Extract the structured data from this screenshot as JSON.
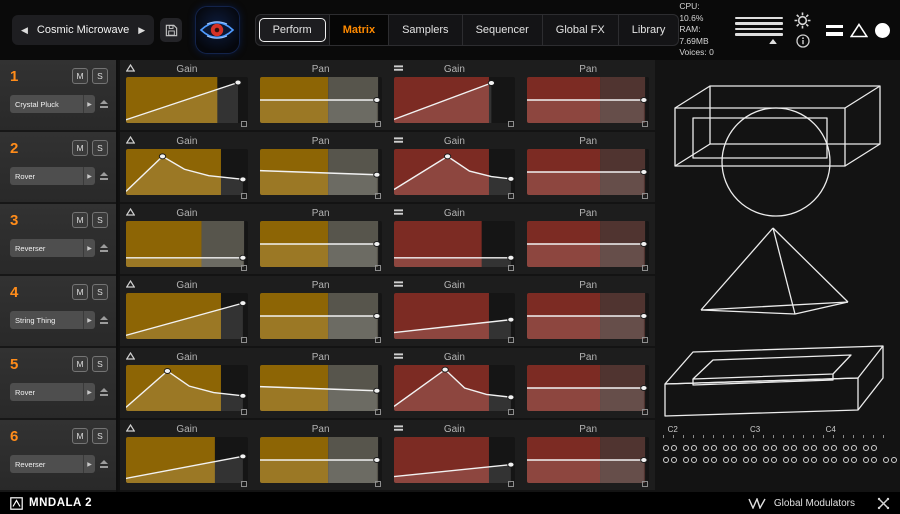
{
  "header": {
    "accent": "#ff8a00",
    "preset": {
      "prev_icon": "◀",
      "next_icon": "▶",
      "name": "Cosmic Microwave"
    },
    "tabs": [
      {
        "label": "Perform",
        "state": "outlined"
      },
      {
        "label": "Matrix",
        "state": "active"
      },
      {
        "label": "Samplers",
        "state": "normal"
      },
      {
        "label": "Sequencer",
        "state": "normal"
      },
      {
        "label": "Global FX",
        "state": "normal"
      },
      {
        "label": "Library",
        "state": "normal"
      }
    ],
    "stats": {
      "cpu": "CPU: 10.6%",
      "ram": "RAM: 7.69MB",
      "voices": "Voices: 0"
    }
  },
  "icons": {
    "select_arrow": "▶"
  },
  "sidebar": {
    "mute_label": "M",
    "solo_label": "S",
    "channels": [
      {
        "num": "1",
        "name": "Crystal Pluck"
      },
      {
        "num": "2",
        "name": "Rover"
      },
      {
        "num": "3",
        "name": "Reverser"
      },
      {
        "num": "4",
        "name": "String Thing"
      },
      {
        "num": "5",
        "name": "Rover"
      },
      {
        "num": "6",
        "name": "Reverser"
      }
    ]
  },
  "matrix": {
    "colors": {
      "amber": "#8d6505",
      "amber_soft": "#57554c",
      "red": "#7c2b23",
      "red_soft": "#503430",
      "line": "#f2f2f2"
    },
    "rows": [
      {
        "cells": [
          {
            "label": "Gain",
            "icon": "triangle",
            "zones": [
              [
                0,
                0.75,
                "amber"
              ]
            ],
            "pts": [
              [
                0,
                0.93
              ],
              [
                0.92,
                0.12
              ]
            ],
            "nodes": [
              [
                0.92,
                0.12
              ]
            ]
          },
          {
            "label": "Pan",
            "icon": "",
            "zones": [
              [
                0,
                0.56,
                "amber"
              ],
              [
                0.56,
                0.97,
                "amber_soft"
              ]
            ],
            "pts": [
              [
                0,
                0.5
              ],
              [
                0.96,
                0.5
              ]
            ],
            "nodes": [
              [
                0.96,
                0.5
              ]
            ]
          },
          {
            "label": "Gain",
            "icon": "bars",
            "zones": [
              [
                0,
                0.78,
                "red"
              ]
            ],
            "pts": [
              [
                0,
                0.92
              ],
              [
                0.8,
                0.13
              ]
            ],
            "nodes": [
              [
                0.8,
                0.13
              ]
            ]
          },
          {
            "label": "Pan",
            "icon": "",
            "zones": [
              [
                0,
                0.6,
                "red"
              ],
              [
                0.6,
                0.97,
                "red_soft"
              ]
            ],
            "pts": [
              [
                0,
                0.5
              ],
              [
                0.96,
                0.5
              ]
            ],
            "nodes": [
              [
                0.96,
                0.5
              ]
            ]
          }
        ]
      },
      {
        "cells": [
          {
            "label": "Gain",
            "icon": "triangle",
            "zones": [
              [
                0,
                0.78,
                "amber"
              ]
            ],
            "pts": [
              [
                0,
                0.92
              ],
              [
                0.3,
                0.16
              ],
              [
                0.48,
                0.44
              ],
              [
                0.68,
                0.58
              ],
              [
                0.96,
                0.66
              ]
            ],
            "nodes": [
              [
                0.3,
                0.16
              ],
              [
                0.96,
                0.66
              ]
            ]
          },
          {
            "label": "Pan",
            "icon": "",
            "zones": [
              [
                0,
                0.56,
                "amber"
              ],
              [
                0.56,
                0.97,
                "amber_soft"
              ]
            ],
            "pts": [
              [
                0,
                0.47
              ],
              [
                0.96,
                0.56
              ]
            ],
            "nodes": [
              [
                0.96,
                0.56
              ]
            ]
          },
          {
            "label": "Gain",
            "icon": "bars",
            "zones": [
              [
                0,
                0.78,
                "red"
              ]
            ],
            "pts": [
              [
                0,
                0.88
              ],
              [
                0.44,
                0.16
              ],
              [
                0.62,
                0.48
              ],
              [
                0.8,
                0.6
              ],
              [
                0.96,
                0.65
              ]
            ],
            "nodes": [
              [
                0.44,
                0.16
              ],
              [
                0.96,
                0.65
              ]
            ]
          },
          {
            "label": "Pan",
            "icon": "",
            "zones": [
              [
                0,
                0.6,
                "red"
              ],
              [
                0.6,
                0.97,
                "red_soft"
              ]
            ],
            "pts": [
              [
                0,
                0.5
              ],
              [
                0.96,
                0.5
              ]
            ],
            "nodes": [
              [
                0.96,
                0.5
              ]
            ]
          }
        ]
      },
      {
        "cells": [
          {
            "label": "Gain",
            "icon": "triangle",
            "zones": [
              [
                0,
                0.62,
                "amber"
              ],
              [
                0.62,
                0.97,
                "amber_soft"
              ]
            ],
            "pts": [
              [
                0,
                0.8
              ],
              [
                0.96,
                0.8
              ]
            ],
            "nodes": [
              [
                0.96,
                0.8
              ]
            ]
          },
          {
            "label": "Pan",
            "icon": "",
            "zones": [
              [
                0,
                0.56,
                "amber"
              ],
              [
                0.56,
                0.97,
                "amber_soft"
              ]
            ],
            "pts": [
              [
                0,
                0.5
              ],
              [
                0.96,
                0.5
              ]
            ],
            "nodes": [
              [
                0.96,
                0.5
              ]
            ]
          },
          {
            "label": "Gain",
            "icon": "bars",
            "zones": [
              [
                0,
                0.72,
                "red"
              ]
            ],
            "pts": [
              [
                0,
                0.8
              ],
              [
                0.96,
                0.8
              ]
            ],
            "nodes": [
              [
                0.96,
                0.8
              ]
            ]
          },
          {
            "label": "Pan",
            "icon": "",
            "zones": [
              [
                0,
                0.6,
                "red"
              ],
              [
                0.6,
                0.97,
                "red_soft"
              ]
            ],
            "pts": [
              [
                0,
                0.5
              ],
              [
                0.96,
                0.5
              ]
            ],
            "nodes": [
              [
                0.96,
                0.5
              ]
            ]
          }
        ]
      },
      {
        "cells": [
          {
            "label": "Gain",
            "icon": "triangle",
            "zones": [
              [
                0,
                0.78,
                "amber"
              ]
            ],
            "pts": [
              [
                0,
                0.92
              ],
              [
                0.96,
                0.22
              ]
            ],
            "nodes": [
              [
                0.96,
                0.22
              ]
            ]
          },
          {
            "label": "Pan",
            "icon": "",
            "zones": [
              [
                0,
                0.56,
                "amber"
              ],
              [
                0.56,
                0.97,
                "amber_soft"
              ]
            ],
            "pts": [
              [
                0,
                0.5
              ],
              [
                0.96,
                0.5
              ]
            ],
            "nodes": [
              [
                0.96,
                0.5
              ]
            ]
          },
          {
            "label": "Gain",
            "icon": "bars",
            "zones": [
              [
                0,
                0.78,
                "red"
              ]
            ],
            "pts": [
              [
                0,
                0.86
              ],
              [
                0.96,
                0.58
              ]
            ],
            "nodes": [
              [
                0.96,
                0.58
              ]
            ]
          },
          {
            "label": "Pan",
            "icon": "",
            "zones": [
              [
                0,
                0.6,
                "red"
              ],
              [
                0.6,
                0.97,
                "red_soft"
              ]
            ],
            "pts": [
              [
                0,
                0.5
              ],
              [
                0.96,
                0.5
              ]
            ],
            "nodes": [
              [
                0.96,
                0.5
              ]
            ]
          }
        ]
      },
      {
        "cells": [
          {
            "label": "Gain",
            "icon": "triangle",
            "zones": [
              [
                0,
                0.78,
                "amber"
              ]
            ],
            "pts": [
              [
                0,
                0.92
              ],
              [
                0.34,
                0.13
              ],
              [
                0.52,
                0.46
              ],
              [
                0.72,
                0.6
              ],
              [
                0.96,
                0.67
              ]
            ],
            "nodes": [
              [
                0.34,
                0.13
              ],
              [
                0.96,
                0.67
              ]
            ]
          },
          {
            "label": "Pan",
            "icon": "",
            "zones": [
              [
                0,
                0.56,
                "amber"
              ],
              [
                0.56,
                0.97,
                "amber_soft"
              ]
            ],
            "pts": [
              [
                0,
                0.47
              ],
              [
                0.96,
                0.56
              ]
            ],
            "nodes": [
              [
                0.96,
                0.56
              ]
            ]
          },
          {
            "label": "Gain",
            "icon": "bars",
            "zones": [
              [
                0,
                0.78,
                "red"
              ]
            ],
            "pts": [
              [
                0,
                0.9
              ],
              [
                0.42,
                0.1
              ],
              [
                0.58,
                0.5
              ],
              [
                0.76,
                0.64
              ],
              [
                0.96,
                0.7
              ]
            ],
            "nodes": [
              [
                0.42,
                0.1
              ],
              [
                0.96,
                0.7
              ]
            ]
          },
          {
            "label": "Pan",
            "icon": "",
            "zones": [
              [
                0,
                0.6,
                "red"
              ],
              [
                0.6,
                0.97,
                "red_soft"
              ]
            ],
            "pts": [
              [
                0,
                0.5
              ],
              [
                0.96,
                0.5
              ]
            ],
            "nodes": [
              [
                0.96,
                0.5
              ]
            ]
          }
        ]
      },
      {
        "cells": [
          {
            "label": "Gain",
            "icon": "triangle",
            "zones": [
              [
                0,
                0.73,
                "amber"
              ]
            ],
            "pts": [
              [
                0,
                0.9
              ],
              [
                0.96,
                0.42
              ]
            ],
            "nodes": [
              [
                0.96,
                0.42
              ]
            ]
          },
          {
            "label": "Pan",
            "icon": "",
            "zones": [
              [
                0,
                0.56,
                "amber"
              ],
              [
                0.56,
                0.97,
                "amber_soft"
              ]
            ],
            "pts": [
              [
                0,
                0.5
              ],
              [
                0.96,
                0.5
              ]
            ],
            "nodes": [
              [
                0.96,
                0.5
              ]
            ]
          },
          {
            "label": "Gain",
            "icon": "bars",
            "zones": [
              [
                0,
                0.78,
                "red"
              ]
            ],
            "pts": [
              [
                0,
                0.86
              ],
              [
                0.96,
                0.6
              ]
            ],
            "nodes": [
              [
                0.96,
                0.6
              ]
            ]
          },
          {
            "label": "Pan",
            "icon": "",
            "zones": [
              [
                0,
                0.6,
                "red"
              ],
              [
                0.6,
                0.97,
                "red_soft"
              ]
            ],
            "pts": [
              [
                0,
                0.5
              ],
              [
                0.96,
                0.5
              ]
            ],
            "nodes": [
              [
                0.96,
                0.5
              ]
            ]
          }
        ]
      }
    ]
  },
  "right_panel": {
    "keyboard": {
      "labels": [
        "C2",
        "C3",
        "C4"
      ],
      "rows": [
        {
          "pairs": 11
        },
        {
          "pairs": 12
        }
      ]
    }
  },
  "footer": {
    "brand": "MNDALA 2",
    "modulators_label": "Global Modulators"
  }
}
